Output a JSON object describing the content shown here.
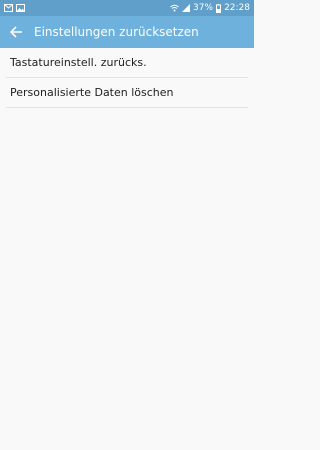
{
  "status_bar": {
    "battery": "37%",
    "time": "22:28",
    "icons_left": [
      "email-icon",
      "image-icon"
    ],
    "icons_right": [
      "wifi-icon",
      "signal-icon",
      "battery-icon"
    ]
  },
  "app_bar": {
    "title": "Einstellungen zurücksetzen",
    "back_icon": "back-arrow-icon"
  },
  "items": [
    {
      "label": "Tastatureinstell. zurücks."
    },
    {
      "label": "Personalisierte Daten löschen"
    }
  ],
  "colors": {
    "status_bar": "#5f9fc9",
    "app_bar": "#6eb1dc",
    "background": "#f9f9f9"
  }
}
